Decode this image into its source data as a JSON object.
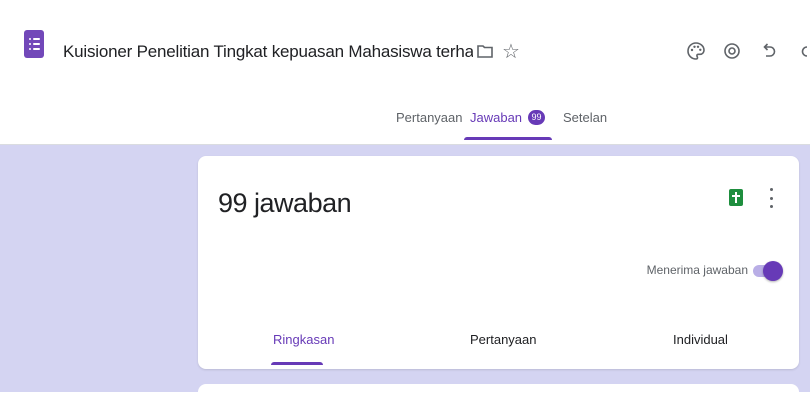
{
  "header": {
    "title": "Kuisioner Penelitian Tingkat kepuasan Mahasiswa terhadap Sistem",
    "icons": [
      "forms-app-icon",
      "folder-icon",
      "star-icon",
      "palette-icon",
      "preview-eye-icon",
      "undo-icon"
    ]
  },
  "tabs": {
    "questions": "Pertanyaan",
    "responses": "Jawaban",
    "responses_badge": "99",
    "settings": "Setelan",
    "active": "responses"
  },
  "responses_card": {
    "count_label": "99 jawaban",
    "accepting_label": "Menerima jawaban",
    "accepting_responses": true,
    "subtabs": {
      "summary": "Ringkasan",
      "question": "Pertanyaan",
      "individual": "Individual",
      "active": "summary"
    }
  },
  "colors": {
    "accent": "#673ab7",
    "canvas": "#d4d4f2",
    "sheets": "#1e8e3e"
  }
}
